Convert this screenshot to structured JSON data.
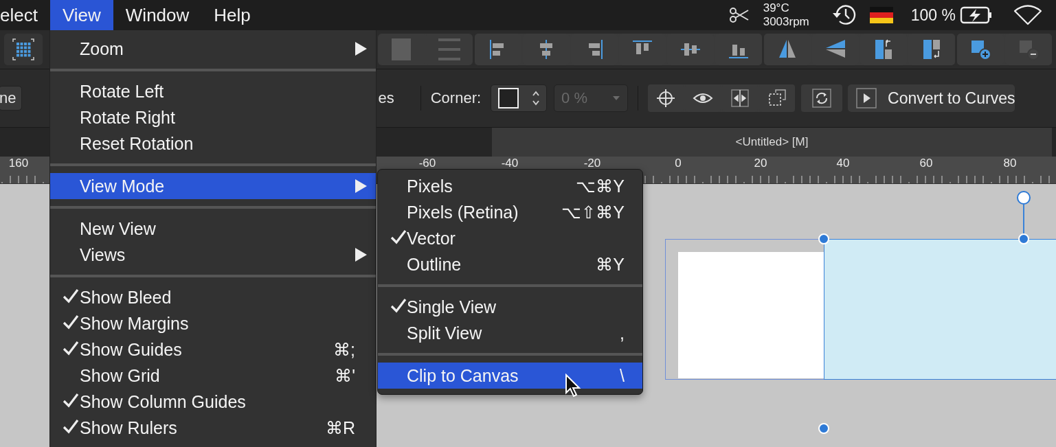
{
  "menubar": {
    "items": [
      {
        "label": "elect",
        "selected": false
      },
      {
        "label": "View",
        "selected": true
      },
      {
        "label": "Window",
        "selected": false
      },
      {
        "label": "Help",
        "selected": false
      }
    ],
    "status": {
      "temperature": "39°C",
      "fan_speed": "3003rpm",
      "battery": "100 %"
    }
  },
  "context_toolbar": {
    "left_button": "ne",
    "partial_label": "es",
    "corner_label": "Corner:",
    "corner_amount": {
      "value": "0 %",
      "disabled": true
    },
    "convert_button": "Convert to Curves"
  },
  "document_tab": {
    "title": "<Untitled> [M]"
  },
  "ruler": {
    "labels": [
      "160",
      "-60",
      "-40",
      "-20",
      "0",
      "20",
      "40",
      "60",
      "80"
    ]
  },
  "view_menu": {
    "items": [
      {
        "kind": "item",
        "label": "Zoom",
        "checked": false,
        "selected": false,
        "has_submenu": true
      },
      {
        "kind": "separator"
      },
      {
        "kind": "item",
        "label": "Rotate Left",
        "checked": false,
        "selected": false,
        "has_submenu": false
      },
      {
        "kind": "item",
        "label": "Rotate Right",
        "checked": false,
        "selected": false,
        "has_submenu": false
      },
      {
        "kind": "item",
        "label": "Reset Rotation",
        "checked": false,
        "selected": false,
        "has_submenu": false
      },
      {
        "kind": "separator"
      },
      {
        "kind": "item",
        "label": "View Mode",
        "checked": false,
        "selected": true,
        "has_submenu": true
      },
      {
        "kind": "separator"
      },
      {
        "kind": "item",
        "label": "New View",
        "checked": false,
        "selected": false,
        "has_submenu": false
      },
      {
        "kind": "item",
        "label": "Views",
        "checked": false,
        "selected": false,
        "has_submenu": true
      },
      {
        "kind": "separator"
      },
      {
        "kind": "item",
        "label": "Show Bleed",
        "checked": true,
        "selected": false,
        "has_submenu": false
      },
      {
        "kind": "item",
        "label": "Show Margins",
        "checked": true,
        "selected": false,
        "has_submenu": false
      },
      {
        "kind": "item",
        "label": "Show Guides",
        "checked": true,
        "selected": false,
        "has_submenu": false,
        "shortcut": "⌘;"
      },
      {
        "kind": "item",
        "label": "Show Grid",
        "checked": false,
        "selected": false,
        "has_submenu": false,
        "shortcut": "⌘'"
      },
      {
        "kind": "item",
        "label": "Show Column Guides",
        "checked": true,
        "selected": false,
        "has_submenu": false
      },
      {
        "kind": "item",
        "label": "Show Rulers",
        "checked": true,
        "selected": false,
        "has_submenu": false,
        "shortcut": "⌘R"
      }
    ]
  },
  "view_mode_submenu": {
    "items": [
      {
        "kind": "item",
        "label": "Pixels",
        "checked": false,
        "selected": false,
        "has_submenu": false,
        "shortcut": "⌥⌘Y"
      },
      {
        "kind": "item",
        "label": "Pixels (Retina)",
        "checked": false,
        "selected": false,
        "has_submenu": false,
        "shortcut": "⌥⇧⌘Y"
      },
      {
        "kind": "item",
        "label": "Vector",
        "checked": true,
        "selected": false,
        "has_submenu": false
      },
      {
        "kind": "item",
        "label": "Outline",
        "checked": false,
        "selected": false,
        "has_submenu": false,
        "shortcut": "⌘Y"
      },
      {
        "kind": "separator"
      },
      {
        "kind": "item",
        "label": "Single View",
        "checked": true,
        "selected": false,
        "has_submenu": false
      },
      {
        "kind": "item",
        "label": "Split View",
        "checked": false,
        "selected": false,
        "has_submenu": false,
        "shortcut": ","
      },
      {
        "kind": "separator"
      },
      {
        "kind": "item",
        "label": "Clip to Canvas",
        "checked": false,
        "selected": true,
        "has_submenu": false,
        "shortcut": "\\"
      }
    ]
  }
}
